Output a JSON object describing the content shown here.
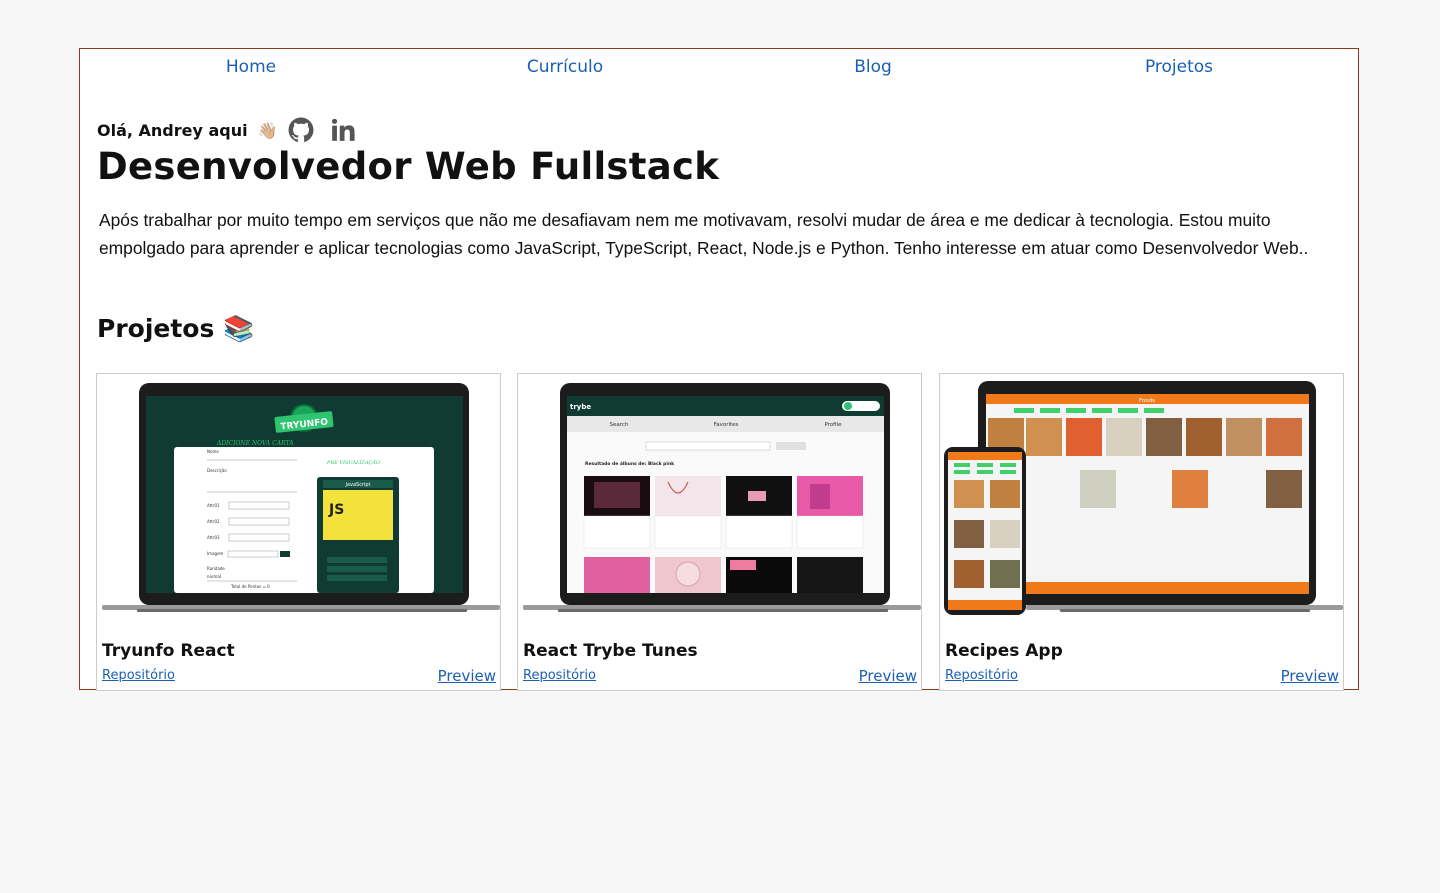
{
  "nav": {
    "items": [
      {
        "label": "Home"
      },
      {
        "label": "Currículo"
      },
      {
        "label": "Blog"
      },
      {
        "label": "Projetos"
      }
    ]
  },
  "hero": {
    "greeting": "Olá, Andrey aqui",
    "wave_emoji": "👋🏼",
    "title": "Desenvolvedor Web Fullstack",
    "bio": "Após trabalhar por muito tempo em serviços que não me desafiavam nem me motivavam, resolvi mudar de área e me dedicar à tecnologia. Estou muito empolgado para aprender e aplicar tecnologias como JavaScript, TypeScript, React, Node.js e Python. Tenho interesse em atuar como Desenvolvedor Web..",
    "icons": [
      "github-icon",
      "linkedin-icon"
    ]
  },
  "projects": {
    "heading": "Projetos 📚",
    "cards": [
      {
        "title": "Tryunfo React",
        "repo_label": "Repositório",
        "preview_label": "Preview",
        "screen": {
          "logo": "TRYUNFO",
          "form_heading": "ADICIONE NOVA CARTA",
          "preview_heading": "PRE VISUALIZAÇÃO",
          "card_name": "JavaScript",
          "field_labels": [
            "Nome",
            "Descrição",
            "Attr01",
            "Attr02",
            "Attr03",
            "Imagem",
            "Raridade"
          ],
          "rarity_value": "normal",
          "total_points": "Total de Pontos = 0"
        }
      },
      {
        "title": "React Trybe Tunes",
        "repo_label": "Repositório",
        "preview_label": "Preview",
        "screen": {
          "tabs": [
            "Search",
            "Favorites",
            "Profile"
          ],
          "results_heading": "Resultado de álbuns de: Black pink"
        }
      },
      {
        "title": "Recipes App",
        "repo_label": "Repositório",
        "preview_label": "Preview",
        "screen": {
          "header": "Foods"
        }
      }
    ]
  },
  "colors": {
    "link": "#1a5fb4",
    "frame_border": "#8b3a1a",
    "tryunfo_bg": "#0f3b33",
    "recipes_orange": "#f07a1a"
  }
}
